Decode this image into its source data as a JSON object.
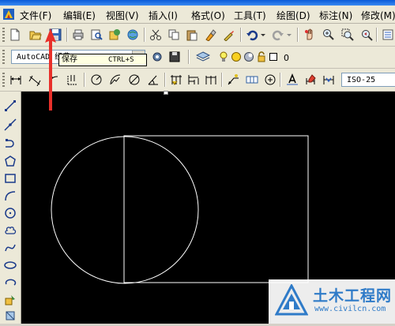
{
  "menubar": {
    "items": [
      "文件(F)",
      "编辑(E)",
      "视图(V)",
      "插入(I)",
      "格式(O)",
      "工具(T)",
      "绘图(D)",
      "标注(N)",
      "修改(M)"
    ]
  },
  "toolbar": {
    "workspace_value": "AutoCAD 经典",
    "layer_value": "0",
    "dimstyle_value": "ISO-25"
  },
  "tooltip": {
    "label": "保存",
    "shortcut": "CTRL+S"
  },
  "watermark": {
    "name": "土木工程网",
    "url": "www.civilcn.com"
  },
  "colors": {
    "canvas": "#000000",
    "geometry": "#ffffff",
    "annotation_arrow": "#e8302a",
    "toolbar": "#ece9d8",
    "watermark_text": "#2f7bc8"
  }
}
